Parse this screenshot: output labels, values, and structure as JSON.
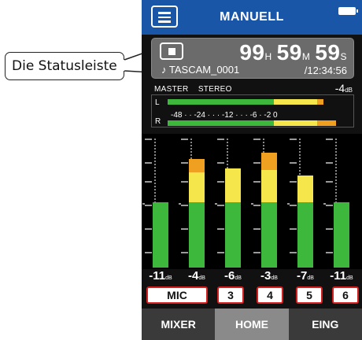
{
  "callout": {
    "label": "Die Statusleiste"
  },
  "titlebar": {
    "title": "MANUELL",
    "menu_icon": "hamburger-menu-icon",
    "battery_icon": "battery-icon"
  },
  "statusbar": {
    "stop_icon": "stop-icon",
    "file_icon": "music-note-icon",
    "file_prefix": "♪ ",
    "filename": "TASCAM_0001",
    "time_hours": "99",
    "time_hours_unit": "H",
    "time_minutes": "59",
    "time_minutes_unit": "M",
    "time_seconds": "59",
    "time_seconds_unit": "S",
    "total_time": "/12:34:56"
  },
  "master": {
    "label": "MASTER",
    "mode": "STEREO",
    "level": "-4",
    "level_unit": "dB",
    "channels": [
      "L",
      "R"
    ],
    "scale": [
      "-48",
      "-24",
      "-12",
      "-6",
      "-2 0"
    ],
    "left_level_fraction": 0.86,
    "right_level_fraction": 0.93
  },
  "channels": [
    {
      "name": "MIC",
      "level": "-11",
      "meter_fraction": 0.49,
      "clip_fraction": 0.0
    },
    {
      "name": "MIC",
      "level": "-4",
      "meter_fraction": 0.81,
      "clip_fraction": 0.1
    },
    {
      "name": "3",
      "level": "-6",
      "meter_fraction": 0.74,
      "clip_fraction": 0.0
    },
    {
      "name": "4",
      "level": "-3",
      "meter_fraction": 0.86,
      "clip_fraction": 0.13
    },
    {
      "name": "5",
      "level": "-7",
      "meter_fraction": 0.69,
      "clip_fraction": 0.0
    },
    {
      "name": "6",
      "level": "-11",
      "meter_fraction": 0.49,
      "clip_fraction": 0.0
    }
  ],
  "level_unit": "dB",
  "channel_buttons": [
    "MIC",
    "3",
    "4",
    "5",
    "6"
  ],
  "tabs": [
    {
      "label": "MIXER",
      "active": false
    },
    {
      "label": "HOME",
      "active": true
    },
    {
      "label": "EING",
      "active": false
    }
  ],
  "colors": {
    "accent": "#1a56a8",
    "meter_green": "#3db83d",
    "meter_yellow": "#f5e64b",
    "meter_orange": "#f0a020",
    "button_border": "#d42020"
  }
}
